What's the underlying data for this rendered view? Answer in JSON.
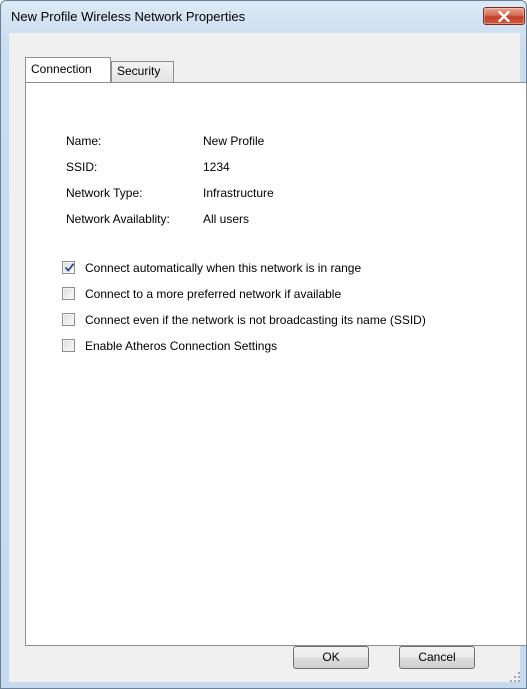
{
  "window": {
    "title": "New Profile Wireless Network Properties"
  },
  "tabs": [
    {
      "label": "Connection",
      "active": true
    },
    {
      "label": "Security",
      "active": false
    }
  ],
  "details": [
    {
      "label": "Name:",
      "value": "New Profile"
    },
    {
      "label": "SSID:",
      "value": "1234"
    },
    {
      "label": "Network Type:",
      "value": "Infrastructure"
    },
    {
      "label": "Network Availablity:",
      "value": "All users"
    }
  ],
  "options": [
    {
      "label": "Connect automatically when this network is in range",
      "checked": true
    },
    {
      "label": "Connect to a more preferred  network if available",
      "checked": false
    },
    {
      "label": "Connect even if  the network is not  broadcasting its name (SSID)",
      "checked": false
    },
    {
      "label": "Enable Atheros Connection Settings",
      "checked": false
    }
  ],
  "buttons": {
    "ok": "OK",
    "cancel": "Cancel"
  },
  "colors": {
    "titlebar": "#cfe0f1",
    "close_button": "#c2402a",
    "check_mark": "#2a4f8a"
  }
}
